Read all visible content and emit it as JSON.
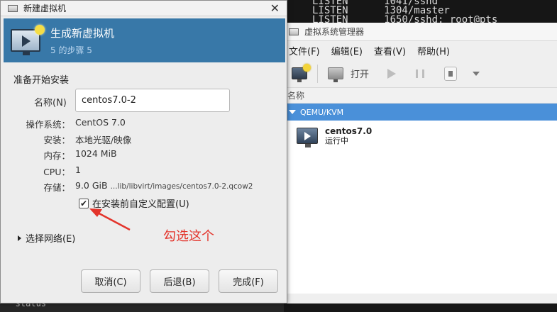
{
  "terminal": {
    "lines": [
      "LISTEN      1041/sshd",
      "LISTEN      1304/master",
      "LISTEN      1650/sshd: root@pts"
    ],
    "bottom_line": "   status"
  },
  "vmm": {
    "title": "虚拟系统管理器",
    "menu": [
      "文件(F)",
      "编辑(E)",
      "查看(V)",
      "帮助(H)"
    ],
    "toolbar": {
      "open_label": "打开"
    },
    "column_header": "名称",
    "group_label": "QEMU/KVM",
    "vms": [
      {
        "name": "centos7.0",
        "status": "运行中"
      }
    ]
  },
  "dialog": {
    "title": "新建虚拟机",
    "banner_title": "生成新虚拟机",
    "banner_step": "5 的步骤 5",
    "section_title": "准备开始安装",
    "name_label": "名称(N)",
    "name_value": "centos7.0-2",
    "info": {
      "os_label": "操作系统：",
      "os_value": "CentOS 7.0",
      "install_label": "安装：",
      "install_value": "本地光驱/映像",
      "memory_label": "内存：",
      "memory_value": "1024 MiB",
      "cpu_label": "CPU：",
      "cpu_value": "1",
      "storage_label": "存储：",
      "storage_size": "9.0 GiB",
      "storage_path": "...lib/libvirt/images/centos7.0-2.qcow2"
    },
    "customize_label": "在安装前自定义配置(U)",
    "customize_checked": true,
    "network_label": "选择网络(E)",
    "buttons": {
      "cancel": "取消(C)",
      "back": "后退(B)",
      "finish": "完成(F)"
    }
  },
  "annotation": {
    "text": "勾选这个",
    "color": "#e3342b"
  },
  "colors": {
    "banner": "#3878a8",
    "selection": "#4a90d9"
  }
}
